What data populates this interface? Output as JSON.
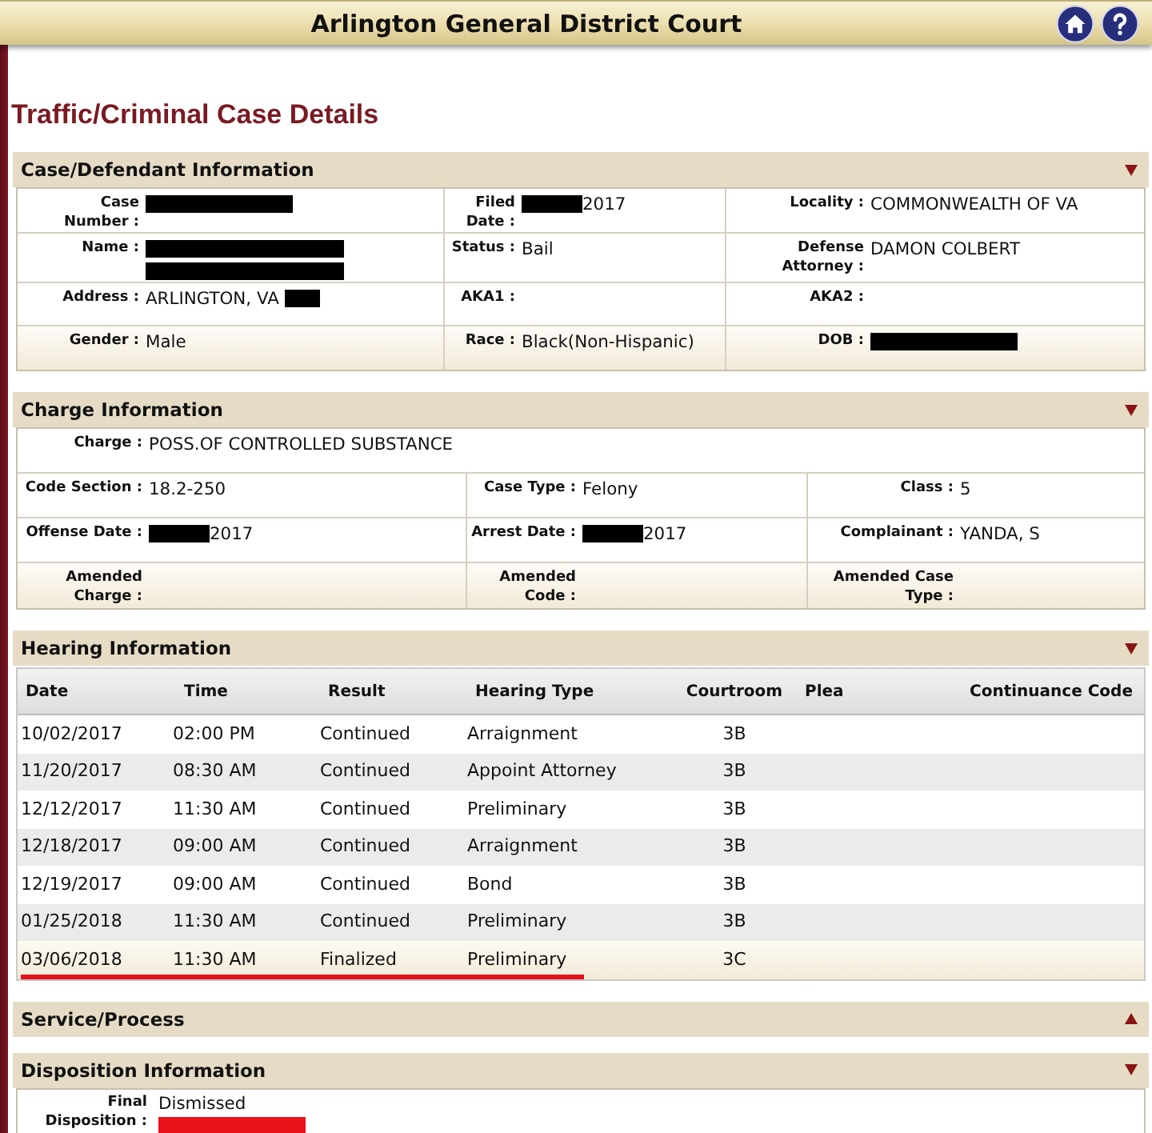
{
  "header": {
    "title": "Arlington General District Court"
  },
  "page_title": "Traffic/Criminal Case Details",
  "sections": [
    {
      "title": "Case/Defendant Information",
      "expanded": true,
      "kind": "fields",
      "rows": [
        [
          {
            "label": "Case Number :",
            "lines": [
              [
                {
                  "kind": "redaction",
                  "color": "#000000"
                }
              ]
            ]
          },
          {
            "label": "Filed Date :",
            "lines": [
              [
                {
                  "kind": "redaction",
                  "color": "#000000"
                },
                {
                  "kind": "text",
                  "text": "2017"
                }
              ]
            ]
          },
          {
            "label": "Locality :",
            "lines": [
              [
                {
                  "kind": "text",
                  "text": "COMMONWEALTH OF VA"
                }
              ]
            ]
          }
        ],
        [
          {
            "label": "Name :",
            "lines": [
              [
                {
                  "kind": "redaction",
                  "color": "#000000"
                }
              ],
              [
                {
                  "kind": "redaction",
                  "color": "#000000"
                }
              ]
            ]
          },
          {
            "label": "Status :",
            "lines": [
              [
                {
                  "kind": "text",
                  "text": "Bail"
                }
              ]
            ]
          },
          {
            "label": "Defense Attorney :",
            "lines": [
              [
                {
                  "kind": "text",
                  "text": "DAMON COLBERT"
                }
              ]
            ]
          }
        ],
        [
          {
            "label": "Address :",
            "lines": [
              [
                {
                  "kind": "text",
                  "text": "ARLINGTON, VA"
                },
                {
                  "kind": "redaction",
                  "color": "#000000"
                }
              ]
            ]
          },
          {
            "label": "AKA1 :"
          },
          {
            "label": "AKA2 :"
          }
        ],
        [
          {
            "label": "Gender :",
            "lines": [
              [
                {
                  "kind": "text",
                  "text": "Male"
                }
              ]
            ]
          },
          {
            "label": "Race :",
            "lines": [
              [
                {
                  "kind": "text",
                  "text": "Black(Non-Hispanic)"
                }
              ]
            ]
          },
          {
            "label": "DOB :",
            "lines": [
              [
                {
                  "kind": "redaction",
                  "color": "#000000"
                }
              ]
            ]
          }
        ]
      ]
    },
    {
      "title": "Charge Information",
      "expanded": true,
      "kind": "fields",
      "rows": [
        [
          {
            "label": "Charge :",
            "lines": [
              [
                {
                  "kind": "text",
                  "text": "POSS.OF CONTROLLED SUBSTANCE"
                }
              ]
            ]
          }
        ],
        [
          {
            "label": "Code Section :",
            "lines": [
              [
                {
                  "kind": "text",
                  "text": "18.2-250"
                }
              ]
            ]
          },
          {
            "label": "Case Type :",
            "lines": [
              [
                {
                  "kind": "text",
                  "text": "Felony"
                }
              ]
            ]
          },
          {
            "label": "Class :",
            "lines": [
              [
                {
                  "kind": "text",
                  "text": "5"
                }
              ]
            ]
          }
        ],
        [
          {
            "label": "Offense Date :",
            "lines": [
              [
                {
                  "kind": "redaction",
                  "color": "#000000"
                },
                {
                  "kind": "text",
                  "text": "2017"
                }
              ]
            ]
          },
          {
            "label": "Arrest Date :",
            "lines": [
              [
                {
                  "kind": "redaction",
                  "color": "#000000"
                },
                {
                  "kind": "text",
                  "text": "2017"
                }
              ]
            ]
          },
          {
            "label": "Complainant :",
            "lines": [
              [
                {
                  "kind": "text",
                  "text": "YANDA, S"
                }
              ]
            ]
          }
        ],
        [
          {
            "label": "Amended Charge :"
          },
          {
            "label": "Amended Code :"
          },
          {
            "label": "Amended Case Type :"
          }
        ]
      ]
    },
    {
      "title": "Hearing Information",
      "expanded": true,
      "kind": "table",
      "columns": [
        "Date",
        "Time",
        "Result",
        "Hearing Type",
        "Courtroom",
        "Plea",
        "Continuance Code"
      ],
      "rows": [
        {
          "cells": [
            "10/02/2017",
            "02:00 PM",
            "Continued",
            "Arraignment",
            "3B"
          ],
          "underlined": false
        },
        {
          "cells": [
            "11/20/2017",
            "08:30 AM",
            "Continued",
            "Appoint Attorney",
            "3B"
          ],
          "underlined": false
        },
        {
          "cells": [
            "12/12/2017",
            "11:30 AM",
            "Continued",
            "Preliminary",
            "3B"
          ],
          "underlined": false
        },
        {
          "cells": [
            "12/18/2017",
            "09:00 AM",
            "Continued",
            "Arraignment",
            "3B"
          ],
          "underlined": false
        },
        {
          "cells": [
            "12/19/2017",
            "09:00 AM",
            "Continued",
            "Bond",
            "3B"
          ],
          "underlined": false
        },
        {
          "cells": [
            "01/25/2018",
            "11:30 AM",
            "Continued",
            "Preliminary",
            "3B"
          ],
          "underlined": false
        },
        {
          "cells": [
            "03/06/2018",
            "11:30 AM",
            "Finalized",
            "Preliminary",
            "3C"
          ],
          "underlined": true
        }
      ]
    },
    {
      "title": "Service/Process",
      "expanded": false
    },
    {
      "title": "Disposition Information",
      "expanded": true,
      "kind": "fields",
      "rows": [
        [
          {
            "label": "Final Disposition :",
            "lines": [
              [
                {
                  "kind": "text",
                  "text": "Dismissed"
                }
              ],
              [
                {
                  "kind": "redaction",
                  "color": "#e8121b"
                }
              ]
            ]
          }
        ]
      ]
    }
  ]
}
